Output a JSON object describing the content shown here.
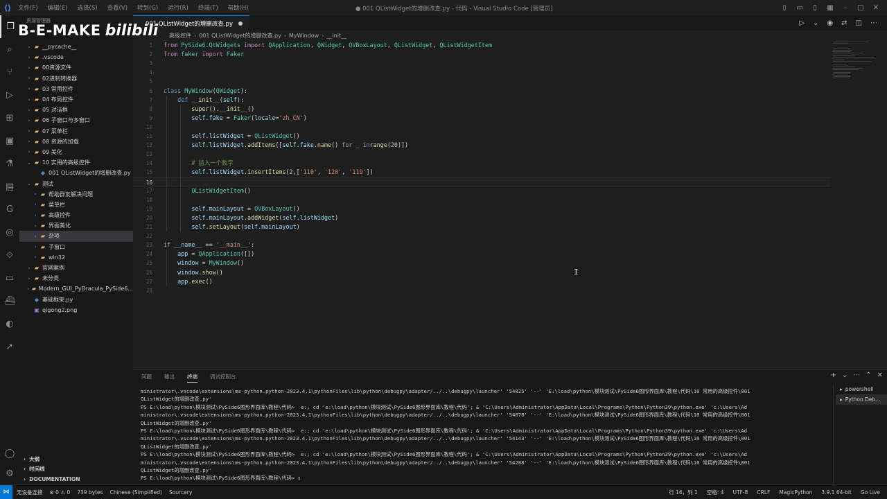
{
  "titlebar": {
    "menu": [
      "文件(F)",
      "编辑(E)",
      "选择(S)",
      "查看(V)",
      "转到(G)",
      "运行(R)",
      "终端(T)",
      "帮助(H)"
    ],
    "window_title": "● 001 QListWidget的增删改查.py - 代码 - Visual Studio Code [管理员]"
  },
  "watermark": {
    "brand": "B-E-MAKE",
    "bili": "bilibili"
  },
  "sidebar": {
    "header": "资源管理器",
    "tree": [
      {
        "label": "__pycache__",
        "type": "folder",
        "indent": 1,
        "expanded": false
      },
      {
        "label": ".vscode",
        "type": "folder",
        "indent": 1,
        "expanded": false
      },
      {
        "label": "00资源文件",
        "type": "folder",
        "indent": 1,
        "expanded": false
      },
      {
        "label": "02进制转换器",
        "type": "folder",
        "indent": 1,
        "expanded": false
      },
      {
        "label": "03 常用控件",
        "type": "folder",
        "indent": 1,
        "expanded": false
      },
      {
        "label": "04 布局控件",
        "type": "folder",
        "indent": 1,
        "expanded": false
      },
      {
        "label": "05 对话框",
        "type": "folder",
        "indent": 1,
        "expanded": false
      },
      {
        "label": "06 子窗口与多窗口",
        "type": "folder",
        "indent": 1,
        "expanded": false
      },
      {
        "label": "07 菜单栏",
        "type": "folder",
        "indent": 1,
        "expanded": false
      },
      {
        "label": "08 资源的加载",
        "type": "folder",
        "indent": 1,
        "expanded": false
      },
      {
        "label": "09 美化",
        "type": "folder",
        "indent": 1,
        "expanded": false
      },
      {
        "label": "10 实用的高级控件",
        "type": "folder",
        "indent": 1,
        "expanded": true
      },
      {
        "label": "001 QListWidget的增删改查.py",
        "type": "py",
        "indent": 2,
        "expanded": null
      },
      {
        "label": "测试",
        "type": "folder",
        "indent": 1,
        "expanded": true
      },
      {
        "label": "帮助群友解决问题",
        "type": "folder",
        "indent": 2,
        "expanded": false
      },
      {
        "label": "菜单栏",
        "type": "folder",
        "indent": 2,
        "expanded": false
      },
      {
        "label": "高级控件",
        "type": "folder",
        "indent": 2,
        "expanded": false
      },
      {
        "label": "界面美化",
        "type": "folder",
        "indent": 2,
        "expanded": false
      },
      {
        "label": "杂项",
        "type": "folder",
        "indent": 2,
        "expanded": false,
        "selected": true
      },
      {
        "label": "子窗口",
        "type": "folder",
        "indent": 2,
        "expanded": false
      },
      {
        "label": "win32",
        "type": "folder",
        "indent": 2,
        "expanded": false
      },
      {
        "label": "官网案例",
        "type": "folder",
        "indent": 1,
        "expanded": false
      },
      {
        "label": "未分类",
        "type": "folder",
        "indent": 1,
        "expanded": false
      },
      {
        "label": "Modern_GUI_PyDracula_PySide6...",
        "type": "folder",
        "indent": 1,
        "expanded": false
      },
      {
        "label": "基础框架.py",
        "type": "py",
        "indent": 1,
        "expanded": null
      },
      {
        "label": "qigong2.png",
        "type": "png",
        "indent": 1,
        "expanded": null
      }
    ],
    "outline": [
      "大纲",
      "时间线",
      "DOCUMENTATION"
    ]
  },
  "tab": {
    "label": "001 QListWidget的增删改查.py"
  },
  "breadcrumb": [
    "高级控件",
    "001 QListWidget的增删改查.py",
    "MyWindow",
    "__init__"
  ],
  "editor": {
    "current_line": 16,
    "lines": [
      {
        "n": 1,
        "tokens": [
          [
            "kw",
            "from "
          ],
          [
            "cls",
            "PySide6"
          ],
          [
            "",
            "."
          ],
          [
            "cls",
            "QtWidgets"
          ],
          [
            "kw",
            " import "
          ],
          [
            "cls",
            "QApplication"
          ],
          [
            "",
            ", "
          ],
          [
            "cls",
            "QWidget"
          ],
          [
            "",
            ", "
          ],
          [
            "cls",
            "QVBoxLayout"
          ],
          [
            "",
            ", "
          ],
          [
            "cls",
            "QListWidget"
          ],
          [
            "",
            ", "
          ],
          [
            "cls",
            "QListWidgetItem"
          ]
        ]
      },
      {
        "n": 2,
        "tokens": [
          [
            "kw",
            "from "
          ],
          [
            "cls",
            "faker"
          ],
          [
            "kw",
            " import "
          ],
          [
            "cls",
            "Faker"
          ]
        ]
      },
      {
        "n": 3,
        "tokens": []
      },
      {
        "n": 4,
        "tokens": []
      },
      {
        "n": 5,
        "tokens": []
      },
      {
        "n": 6,
        "tokens": [
          [
            "kw2",
            "class "
          ],
          [
            "cls",
            "MyWindow"
          ],
          [
            "",
            "("
          ],
          [
            "cls",
            "QWidget"
          ],
          [
            "",
            "):"
          ]
        ]
      },
      {
        "n": 7,
        "tokens": [
          [
            "",
            "    "
          ],
          [
            "kw2",
            "def "
          ],
          [
            "fn",
            "__init__"
          ],
          [
            "",
            "("
          ],
          [
            "var",
            "self"
          ],
          [
            "",
            "):"
          ]
        ]
      },
      {
        "n": 8,
        "tokens": [
          [
            "",
            "        "
          ],
          [
            "fn",
            "super"
          ],
          [
            "",
            "()."
          ],
          [
            "fn",
            "__init__"
          ],
          [
            "",
            "()"
          ]
        ]
      },
      {
        "n": 9,
        "tokens": [
          [
            "",
            "        "
          ],
          [
            "var",
            "self"
          ],
          [
            "",
            "."
          ],
          [
            "var",
            "fake"
          ],
          [
            "",
            " = "
          ],
          [
            "cls",
            "Faker"
          ],
          [
            "",
            "("
          ],
          [
            "var",
            "locale"
          ],
          [
            "",
            "="
          ],
          [
            "str",
            "'zh_CN'"
          ],
          [
            "",
            ")"
          ]
        ]
      },
      {
        "n": 10,
        "tokens": []
      },
      {
        "n": 11,
        "tokens": [
          [
            "",
            "        "
          ],
          [
            "var",
            "self"
          ],
          [
            "",
            "."
          ],
          [
            "var",
            "listWidget"
          ],
          [
            "",
            " = "
          ],
          [
            "cls",
            "QListWidget"
          ],
          [
            "",
            "()"
          ]
        ]
      },
      {
        "n": 12,
        "tokens": [
          [
            "",
            "        "
          ],
          [
            "var",
            "self"
          ],
          [
            "",
            "."
          ],
          [
            "var",
            "listWidget"
          ],
          [
            "",
            "."
          ],
          [
            "fn",
            "addItems"
          ],
          [
            "",
            "(["
          ],
          [
            "var",
            "self"
          ],
          [
            "",
            "."
          ],
          [
            "var",
            "fake"
          ],
          [
            "",
            "."
          ],
          [
            "fn",
            "name"
          ],
          [
            "",
            "() "
          ],
          [
            "kw",
            "for"
          ],
          [
            "",
            " _ "
          ],
          [
            "kw",
            "in"
          ],
          [
            " ",
            ""
          ],
          [
            "fn",
            "range"
          ],
          [
            "",
            "("
          ],
          [
            "num",
            "20"
          ],
          [
            "",
            ")])"
          ]
        ]
      },
      {
        "n": 13,
        "tokens": []
      },
      {
        "n": 14,
        "tokens": [
          [
            "",
            "        "
          ],
          [
            "cmt",
            "# 插入一个数字"
          ]
        ]
      },
      {
        "n": 15,
        "tokens": [
          [
            "",
            "        "
          ],
          [
            "var",
            "self"
          ],
          [
            "",
            "."
          ],
          [
            "var",
            "listWidget"
          ],
          [
            "",
            "."
          ],
          [
            "fn",
            "insertItems"
          ],
          [
            "",
            "("
          ],
          [
            "num",
            "2"
          ],
          [
            "",
            ",["
          ],
          [
            "str",
            "'110'"
          ],
          [
            "",
            ", "
          ],
          [
            "str",
            "'120'"
          ],
          [
            "",
            ", "
          ],
          [
            "str",
            "'119'"
          ],
          [
            "",
            "])"
          ]
        ]
      },
      {
        "n": 16,
        "tokens": []
      },
      {
        "n": 17,
        "tokens": [
          [
            "",
            "        "
          ],
          [
            "cls",
            "QListWidgetItem"
          ],
          [
            "",
            "()"
          ]
        ]
      },
      {
        "n": 18,
        "tokens": []
      },
      {
        "n": 19,
        "tokens": [
          [
            "",
            "        "
          ],
          [
            "var",
            "self"
          ],
          [
            "",
            "."
          ],
          [
            "var",
            "mainLayout"
          ],
          [
            "",
            " = "
          ],
          [
            "cls",
            "QVBoxLayout"
          ],
          [
            "",
            "()"
          ]
        ]
      },
      {
        "n": 20,
        "tokens": [
          [
            "",
            "        "
          ],
          [
            "var",
            "self"
          ],
          [
            "",
            "."
          ],
          [
            "var",
            "mainLayout"
          ],
          [
            "",
            "."
          ],
          [
            "fn",
            "addWidget"
          ],
          [
            "",
            "("
          ],
          [
            "var",
            "self"
          ],
          [
            "",
            "."
          ],
          [
            "var",
            "listWidget"
          ],
          [
            "",
            ")"
          ]
        ]
      },
      {
        "n": 21,
        "tokens": [
          [
            "",
            "        "
          ],
          [
            "var",
            "self"
          ],
          [
            "",
            "."
          ],
          [
            "fn",
            "setLayout"
          ],
          [
            "",
            "("
          ],
          [
            "var",
            "self"
          ],
          [
            "",
            "."
          ],
          [
            "var",
            "mainLayout"
          ],
          [
            "",
            ")"
          ]
        ]
      },
      {
        "n": 22,
        "tokens": []
      },
      {
        "n": 23,
        "tokens": [
          [
            "kw",
            "if "
          ],
          [
            "var",
            "__name__"
          ],
          [
            "",
            " == "
          ],
          [
            "str",
            "'__main__'"
          ],
          [
            "",
            ":"
          ]
        ]
      },
      {
        "n": 24,
        "tokens": [
          [
            "",
            "    "
          ],
          [
            "var",
            "app"
          ],
          [
            "",
            " = "
          ],
          [
            "cls",
            "QApplication"
          ],
          [
            "",
            "([])"
          ]
        ]
      },
      {
        "n": 25,
        "tokens": [
          [
            "",
            "    "
          ],
          [
            "var",
            "window"
          ],
          [
            "",
            " = "
          ],
          [
            "cls",
            "MyWindow"
          ],
          [
            "",
            "()"
          ]
        ]
      },
      {
        "n": 26,
        "tokens": [
          [
            "",
            "    "
          ],
          [
            "var",
            "window"
          ],
          [
            "",
            "."
          ],
          [
            "fn",
            "show"
          ],
          [
            "",
            "()"
          ]
        ]
      },
      {
        "n": 27,
        "tokens": [
          [
            "",
            "    "
          ],
          [
            "var",
            "app"
          ],
          [
            "",
            "."
          ],
          [
            "fn",
            "exec"
          ],
          [
            "",
            "()"
          ]
        ]
      },
      {
        "n": 28,
        "tokens": []
      }
    ]
  },
  "panel": {
    "tabs": [
      "问题",
      "输出",
      "终端",
      "调试控制台"
    ],
    "active_tab": "终端",
    "terminal_lines": [
      "ministrator\\.vscode\\extensions\\ms-python.python-2023.4.1\\pythonFiles\\lib\\python\\debugpy\\adapter/../..\\debugpy\\launcher' '54025' '--' 'E:\\load\\python\\模块测试\\PySide6图形界面库\\教程\\代码\\10 常用的高级控件\\001",
      "QListWidget的增删改查.py'",
      "PS E:\\load\\python\\模块测试\\PySide6图形界面库\\教程\\代码>  e:; cd 'e:\\load\\python\\模块测试\\PySide6图形界面库\\教程\\代码'; & 'C:\\Users\\Administrator\\AppData\\Local\\Programs\\Python\\Python39\\python.exe' 'c:\\Users\\Ad",
      "ministrator\\.vscode\\extensions\\ms-python.python-2023.4.1\\pythonFiles\\lib\\python\\debugpy\\adapter/../..\\debugpy\\launcher' '54078' '--' 'E:\\load\\python\\模块测试\\PySide6图形界面库\\教程\\代码\\10 常用的高级控件\\001",
      "QListWidget的增删改查.py'",
      "PS E:\\load\\python\\模块测试\\PySide6图形界面库\\教程\\代码>  e:; cd 'e:\\load\\python\\模块测试\\PySide6图形界面库\\教程\\代码'; & 'C:\\Users\\Administrator\\AppData\\Local\\Programs\\Python\\Python39\\python.exe' 'c:\\Users\\Ad",
      "ministrator\\.vscode\\extensions\\ms-python.python-2023.4.1\\pythonFiles\\lib\\python\\debugpy\\adapter/../..\\debugpy\\launcher' '54143' '--' 'E:\\load\\python\\模块测试\\PySide6图形界面库\\教程\\代码\\10 常用的高级控件\\001",
      "QListWidget的增删改查.py'",
      "PS E:\\load\\python\\模块测试\\PySide6图形界面库\\教程\\代码>  e:; cd 'e:\\load\\python\\模块测试\\PySide6图形界面库\\教程\\代码'; & 'C:\\Users\\Administrator\\AppData\\Local\\Programs\\Python\\Python39\\python.exe' 'c:\\Users\\Ad",
      "ministrator\\.vscode\\extensions\\ms-python.python-2023.4.1\\pythonFiles\\lib\\python\\debugpy\\adapter/../..\\debugpy\\launcher' '54288' '--' 'E:\\load\\python\\模块测试\\PySide6图形界面库\\教程\\代码\\10 常用的高级控件\\001",
      "QListWidget的增删改查.py'",
      "PS E:\\load\\python\\模块测试\\PySide6图形界面库\\教程\\代码> ▯"
    ],
    "terminals": [
      "powershell",
      "Python Deb..."
    ]
  },
  "statusbar": {
    "left": [
      "无设备连接",
      "⊗ 0  ⚠ 0",
      "739 bytes",
      "Chinese (Simplified)",
      "Sourcery"
    ],
    "right": [
      "行 16，列 1",
      "空格: 4",
      "UTF-8",
      "CRLF",
      "MagicPython",
      "3.9.1 64-bit",
      "Go Live"
    ]
  },
  "colors": {
    "accent": "#0078d4",
    "background": "#1e1e1e",
    "sidebar": "#181818"
  }
}
